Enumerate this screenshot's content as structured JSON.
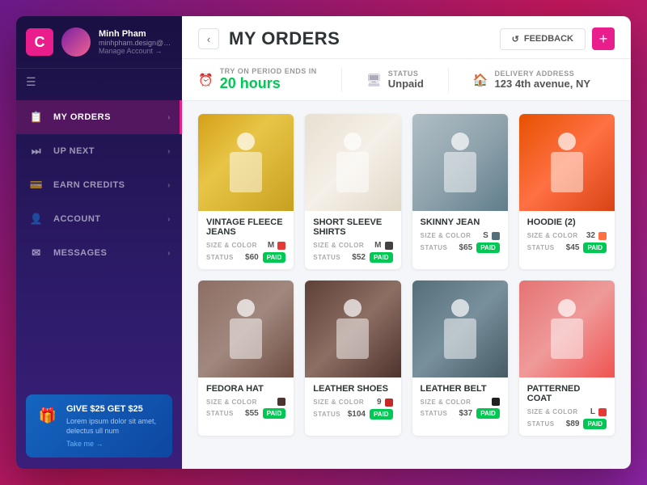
{
  "app": {
    "logo": "C",
    "user": {
      "name": "Minh Pham",
      "email": "minhpham.design@gmail.com",
      "manage": "Manage Account →"
    }
  },
  "sidebar": {
    "items": [
      {
        "id": "my-orders",
        "label": "MY ORDERS",
        "active": true,
        "icon": "📋"
      },
      {
        "id": "up-next",
        "label": "UP NEXT",
        "active": false,
        "icon": "⏭"
      },
      {
        "id": "earn-credits",
        "label": "EARN CREDITS",
        "active": false,
        "icon": "💳"
      },
      {
        "id": "account",
        "label": "ACCOUNT",
        "active": false,
        "icon": "👤"
      },
      {
        "id": "messages",
        "label": "MESSAGES",
        "active": false,
        "icon": "✉"
      }
    ],
    "promo": {
      "title": "GIVE $25 GET $25",
      "sub": "Lorem ipsum dolor sit amet, delectus ull num",
      "link": "Take me →"
    }
  },
  "header": {
    "title": "MY ORDERS",
    "back_label": "‹",
    "feedback_label": "FEEDBACK",
    "add_label": "+"
  },
  "order_meta": {
    "try_on_label": "TRY ON PERIOD ENDS IN",
    "try_on_value": "20 hours",
    "status_label": "STATUS",
    "status_value": "Unpaid",
    "delivery_label": "DELIVERY ADDRESS",
    "delivery_value": "123 4th avenue, NY"
  },
  "orders": [
    {
      "id": "vintage-fleece-jeans",
      "title": "VINTAGE FLEECE JEANS",
      "size": "M",
      "color": "#e53935",
      "price": "$60",
      "status": "PAID",
      "badge": "paid",
      "img_class": "img-jeans"
    },
    {
      "id": "short-sleeve-shirts",
      "title": "SHORT SLEEVE SHIRTS",
      "size": "M",
      "color": "#424242",
      "price": "$52",
      "status": "PAID",
      "badge": "paid",
      "img_class": "img-shirts"
    },
    {
      "id": "skinny-jean",
      "title": "SKINNY JEAN",
      "size": "S",
      "color": "#546e7a",
      "price": "$65",
      "status": "PAID",
      "badge": "paid",
      "img_class": "img-skinny"
    },
    {
      "id": "hoodie",
      "title": "HOODIE (2)",
      "size": "32",
      "color": "#ff7043",
      "price": "$45",
      "status": "PAID",
      "badge": "paid",
      "img_class": "img-hoodie"
    },
    {
      "id": "fedora-hat",
      "title": "FEDORA HAT",
      "size": "",
      "color": "#4e342e",
      "price": "$55",
      "status": "PAID",
      "badge": "paid",
      "img_class": "img-fedora"
    },
    {
      "id": "leather-shoes",
      "title": "LEATHER SHOES",
      "size": "9",
      "color": "#c62828",
      "price": "$104",
      "status": "PAID",
      "badge": "paid",
      "img_class": "img-shoes"
    },
    {
      "id": "leather-belt",
      "title": "LEATHER BELT",
      "size": "",
      "color": "#212121",
      "price": "$37",
      "status": "PAID",
      "badge": "paid",
      "img_class": "img-belt"
    },
    {
      "id": "patterned-coat",
      "title": "PATTERNED COAT",
      "size": "L",
      "color": "#e53935",
      "price": "$89",
      "status": "PAID",
      "badge": "paid",
      "img_class": "img-coat"
    }
  ],
  "colors": {
    "accent": "#e91e8c",
    "sidebar_bg": "#1a1042",
    "active_nav": "rgba(233,30,140,0.25)"
  }
}
